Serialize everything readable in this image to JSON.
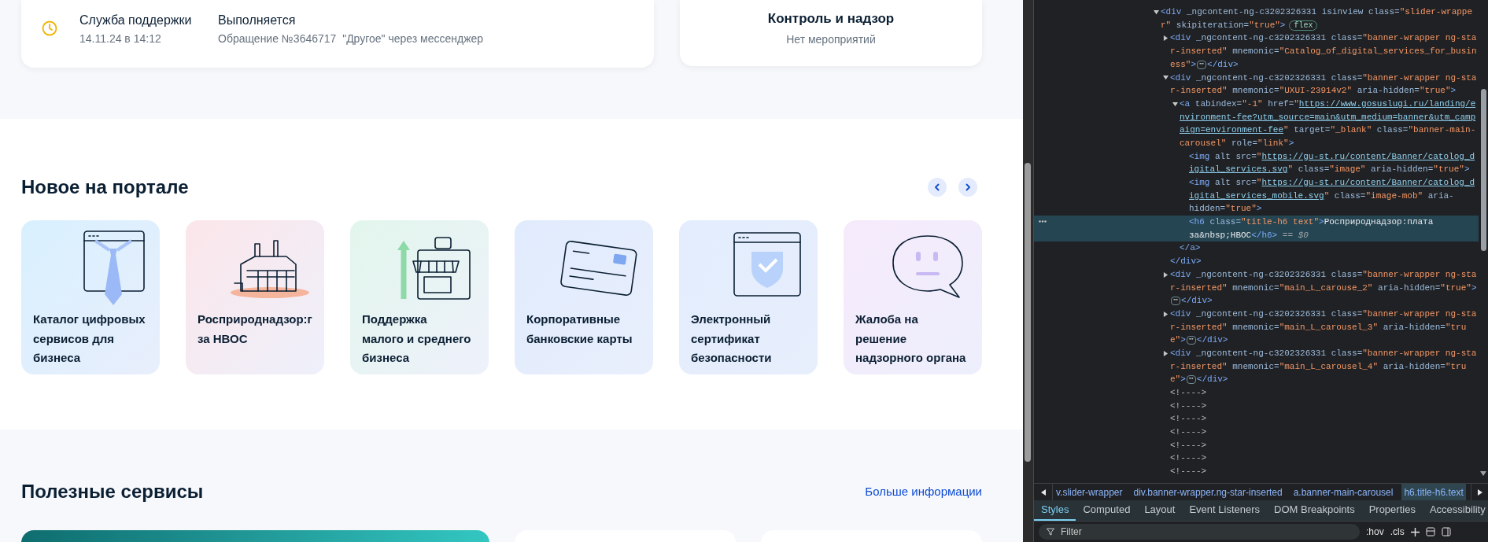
{
  "support_card": {
    "title": "Служба поддержки",
    "date": "14.11.24 в 14:12",
    "status": "Выполняется",
    "description": "Обращение №3646717  \"Другое\" через мессенджер"
  },
  "control_card": {
    "title": "Контроль и надзор",
    "subtitle": "Нет мероприятий"
  },
  "news": {
    "title": "Новое на портале",
    "cards": [
      {
        "kind": "tie-window",
        "title_lines": [
          "Каталог цифровых",
          "сервисов для",
          "бизнеса"
        ]
      },
      {
        "kind": "factory",
        "title_lines": [
          "Росприроднадзор:г",
          "за НВОС"
        ]
      },
      {
        "kind": "shop",
        "title_lines": [
          "Поддержка",
          "малого и среднего",
          "бизнеса"
        ]
      },
      {
        "kind": "bank-card",
        "title_lines": [
          "Корпоративные",
          "банковские карты"
        ]
      },
      {
        "kind": "shield-window",
        "title_lines": [
          "Электронный",
          "сертификат",
          "безопасности"
        ]
      },
      {
        "kind": "speech-bubble",
        "title_lines": [
          "Жалоба на",
          "решение",
          "надзорного органа"
        ]
      }
    ]
  },
  "useful": {
    "title": "Полезные сервисы",
    "link": "Больше информации"
  },
  "devtools": {
    "tree": [
      {
        "selected": false,
        "expanded": true,
        "lines": [
          [
            {
              "kind": "tag",
              "text": "<div"
            },
            {
              "kind": "attr",
              "text": " _ngcontent-ng-c3202326331 isinview class="
            },
            {
              "kind": "val",
              "text": "\"slider-wrappe"
            }
          ],
          [
            {
              "kind": "val",
              "text": "r\""
            },
            {
              "kind": "attr",
              "text": " skipiteration="
            },
            {
              "kind": "val",
              "text": "\"true\""
            },
            {
              "kind": "tag",
              "text": ">"
            },
            {
              "kind": "badge",
              "text": "flex"
            }
          ]
        ],
        "children": [
          {
            "selected": false,
            "expanded": false,
            "lines": [
              [
                {
                  "kind": "tag",
                  "text": "<div"
                },
                {
                  "kind": "attr",
                  "text": " _ngcontent-ng-c3202326331 class="
                },
                {
                  "kind": "val",
                  "text": "\"banner-wrapper ng-sta"
                }
              ],
              [
                {
                  "kind": "val",
                  "text": "r-inserted\""
                },
                {
                  "kind": "attr",
                  "text": " mnemonic="
                },
                {
                  "kind": "val",
                  "text": "\"Catalog_of_digital_services_for_busin"
                }
              ],
              [
                {
                  "kind": "val",
                  "text": "ess\""
                },
                {
                  "kind": "tag",
                  "text": ">"
                },
                {
                  "kind": "ellipsis",
                  "text": "⋯"
                },
                {
                  "kind": "tag",
                  "text": "</div>"
                }
              ]
            ]
          },
          {
            "selected": false,
            "expanded": true,
            "lines": [
              [
                {
                  "kind": "tag",
                  "text": "<div"
                },
                {
                  "kind": "attr",
                  "text": " _ngcontent-ng-c3202326331 class="
                },
                {
                  "kind": "val",
                  "text": "\"banner-wrapper ng-sta"
                }
              ],
              [
                {
                  "kind": "val",
                  "text": "r-inserted\""
                },
                {
                  "kind": "attr",
                  "text": " mnemonic="
                },
                {
                  "kind": "val",
                  "text": "\"UXUI-23914v2\""
                },
                {
                  "kind": "attr",
                  "text": " aria-hidden="
                },
                {
                  "kind": "val",
                  "text": "\"true\""
                },
                {
                  "kind": "tag",
                  "text": ">"
                }
              ]
            ],
            "closing": [
              {
                "kind": "tag",
                "text": "</div>"
              }
            ],
            "children": [
              {
                "selected": false,
                "expanded": true,
                "lines": [
                  [
                    {
                      "kind": "tag",
                      "text": "<a"
                    },
                    {
                      "kind": "attr",
                      "text": " tabindex="
                    },
                    {
                      "kind": "val",
                      "text": "\"-1\""
                    },
                    {
                      "kind": "attr",
                      "text": " href="
                    },
                    {
                      "kind": "val",
                      "text": "\""
                    },
                    {
                      "kind": "link",
                      "text": "https://www.gosuslugi.ru/landing/e"
                    }
                  ],
                  [
                    {
                      "kind": "link",
                      "text": "nvironment-fee?utm_source=main&utm_medium=banner&utm_camp"
                    }
                  ],
                  [
                    {
                      "kind": "link",
                      "text": "aign=environment-fee"
                    },
                    {
                      "kind": "val",
                      "text": "\""
                    },
                    {
                      "kind": "attr",
                      "text": " target="
                    },
                    {
                      "kind": "val",
                      "text": "\"_blank\""
                    },
                    {
                      "kind": "attr",
                      "text": " class="
                    },
                    {
                      "kind": "val",
                      "text": "\"banner-main-"
                    }
                  ],
                  [
                    {
                      "kind": "val",
                      "text": "carousel\""
                    },
                    {
                      "kind": "attr",
                      "text": " role="
                    },
                    {
                      "kind": "val",
                      "text": "\"link\""
                    },
                    {
                      "kind": "tag",
                      "text": ">"
                    }
                  ]
                ],
                "closing": [
                  {
                    "kind": "tag",
                    "text": "</a>"
                  }
                ],
                "children": [
                  {
                    "selected": false,
                    "lines": [
                      [
                        {
                          "kind": "tag",
                          "text": "<img"
                        },
                        {
                          "kind": "attr",
                          "text": " alt src="
                        },
                        {
                          "kind": "val",
                          "text": "\""
                        },
                        {
                          "kind": "link",
                          "text": "https://gu-st.ru/content/Banner/catolog_d"
                        }
                      ],
                      [
                        {
                          "kind": "link",
                          "text": "igital_services.svg"
                        },
                        {
                          "kind": "val",
                          "text": "\""
                        },
                        {
                          "kind": "attr",
                          "text": " class="
                        },
                        {
                          "kind": "val",
                          "text": "\"image\""
                        },
                        {
                          "kind": "attr",
                          "text": " aria-hidden="
                        },
                        {
                          "kind": "val",
                          "text": "\"true\""
                        },
                        {
                          "kind": "tag",
                          "text": ">"
                        }
                      ]
                    ]
                  },
                  {
                    "selected": false,
                    "lines": [
                      [
                        {
                          "kind": "tag",
                          "text": "<img"
                        },
                        {
                          "kind": "attr",
                          "text": " alt src="
                        },
                        {
                          "kind": "val",
                          "text": "\""
                        },
                        {
                          "kind": "link",
                          "text": "https://gu-st.ru/content/Banner/catolog_d"
                        }
                      ],
                      [
                        {
                          "kind": "link",
                          "text": "igital_services_mobile.svg"
                        },
                        {
                          "kind": "val",
                          "text": "\""
                        },
                        {
                          "kind": "attr",
                          "text": " class="
                        },
                        {
                          "kind": "val",
                          "text": "\"image-mob\""
                        },
                        {
                          "kind": "attr",
                          "text": " aria-"
                        }
                      ],
                      [
                        {
                          "kind": "attr",
                          "text": "hidden="
                        },
                        {
                          "kind": "val",
                          "text": "\"true\""
                        },
                        {
                          "kind": "tag",
                          "text": ">"
                        }
                      ]
                    ]
                  },
                  {
                    "selected": true,
                    "lines": [
                      [
                        {
                          "kind": "tag",
                          "text": "<h6"
                        },
                        {
                          "kind": "attr",
                          "text": " class="
                        },
                        {
                          "kind": "val",
                          "text": "\"title-h6 text\""
                        },
                        {
                          "kind": "tag",
                          "text": ">"
                        },
                        {
                          "kind": "text",
                          "text": "Росприроднадзор:плата"
                        }
                      ],
                      [
                        {
                          "kind": "text",
                          "text": "за&nbsp;НВОС"
                        },
                        {
                          "kind": "tag",
                          "text": "</h6>"
                        },
                        {
                          "kind": "dim",
                          "text": " == $0"
                        }
                      ]
                    ]
                  }
                ]
              }
            ]
          },
          {
            "selected": false,
            "expanded": false,
            "lines": [
              [
                {
                  "kind": "tag",
                  "text": "<div"
                },
                {
                  "kind": "attr",
                  "text": " _ngcontent-ng-c3202326331 class="
                },
                {
                  "kind": "val",
                  "text": "\"banner-wrapper ng-sta"
                }
              ],
              [
                {
                  "kind": "val",
                  "text": "r-inserted\""
                },
                {
                  "kind": "attr",
                  "text": " mnemonic="
                },
                {
                  "kind": "val",
                  "text": "\"main_L_carouse_2\""
                },
                {
                  "kind": "attr",
                  "text": " aria-hidden="
                },
                {
                  "kind": "val",
                  "text": "\"true\""
                },
                {
                  "kind": "tag",
                  "text": ">"
                }
              ],
              [
                {
                  "kind": "ellipsis",
                  "text": "⋯"
                },
                {
                  "kind": "tag",
                  "text": "</div>"
                }
              ]
            ]
          },
          {
            "selected": false,
            "expanded": false,
            "lines": [
              [
                {
                  "kind": "tag",
                  "text": "<div"
                },
                {
                  "kind": "attr",
                  "text": " _ngcontent-ng-c3202326331 class="
                },
                {
                  "kind": "val",
                  "text": "\"banner-wrapper ng-sta"
                }
              ],
              [
                {
                  "kind": "val",
                  "text": "r-inserted\""
                },
                {
                  "kind": "attr",
                  "text": " mnemonic="
                },
                {
                  "kind": "val",
                  "text": "\"main_L_carousel_3\""
                },
                {
                  "kind": "attr",
                  "text": " aria-hidden="
                },
                {
                  "kind": "val",
                  "text": "\"tru"
                }
              ],
              [
                {
                  "kind": "val",
                  "text": "e\""
                },
                {
                  "kind": "tag",
                  "text": ">"
                },
                {
                  "kind": "ellipsis",
                  "text": "⋯"
                },
                {
                  "kind": "tag",
                  "text": "</div>"
                }
              ]
            ]
          },
          {
            "selected": false,
            "expanded": false,
            "lines": [
              [
                {
                  "kind": "tag",
                  "text": "<div"
                },
                {
                  "kind": "attr",
                  "text": " _ngcontent-ng-c3202326331 class="
                },
                {
                  "kind": "val",
                  "text": "\"banner-wrapper ng-sta"
                }
              ],
              [
                {
                  "kind": "val",
                  "text": "r-inserted\""
                },
                {
                  "kind": "attr",
                  "text": " mnemonic="
                },
                {
                  "kind": "val",
                  "text": "\"main_L_carousel_4\""
                },
                {
                  "kind": "attr",
                  "text": " aria-hidden="
                },
                {
                  "kind": "val",
                  "text": "\"tru"
                }
              ],
              [
                {
                  "kind": "val",
                  "text": "e\""
                },
                {
                  "kind": "tag",
                  "text": ">"
                },
                {
                  "kind": "ellipsis",
                  "text": "⋯"
                },
                {
                  "kind": "tag",
                  "text": "</div>"
                }
              ]
            ]
          },
          {
            "selected": false,
            "lines": [
              [
                {
                  "kind": "comment",
                  "text": "<!---->"
                }
              ]
            ]
          },
          {
            "selected": false,
            "lines": [
              [
                {
                  "kind": "comment",
                  "text": "<!---->"
                }
              ]
            ]
          },
          {
            "selected": false,
            "lines": [
              [
                {
                  "kind": "comment",
                  "text": "<!---->"
                }
              ]
            ]
          },
          {
            "selected": false,
            "lines": [
              [
                {
                  "kind": "comment",
                  "text": "<!---->"
                }
              ]
            ]
          },
          {
            "selected": false,
            "lines": [
              [
                {
                  "kind": "comment",
                  "text": "<!---->"
                }
              ]
            ]
          },
          {
            "selected": false,
            "lines": [
              [
                {
                  "kind": "comment",
                  "text": "<!---->"
                }
              ]
            ]
          },
          {
            "selected": false,
            "lines": [
              [
                {
                  "kind": "comment",
                  "text": "<!---->"
                }
              ]
            ]
          }
        ]
      }
    ],
    "breadcrumbs": [
      {
        "label": "v.slider-wrapper",
        "selected": false
      },
      {
        "label": "div.banner-wrapper.ng-star-inserted",
        "selected": false
      },
      {
        "label": "a.banner-main-carousel",
        "selected": false
      },
      {
        "label": "h6.title-h6.text",
        "selected": true
      }
    ],
    "tabs": [
      {
        "label": "Styles",
        "selected": true
      },
      {
        "label": "Computed",
        "selected": false
      },
      {
        "label": "Layout",
        "selected": false
      },
      {
        "label": "Event Listeners",
        "selected": false
      },
      {
        "label": "DOM Breakpoints",
        "selected": false
      },
      {
        "label": "Properties",
        "selected": false
      },
      {
        "label": "Accessibility",
        "selected": false
      }
    ],
    "filter": {
      "placeholder": "Filter"
    },
    "toggles": [
      ":hov",
      ".cls"
    ]
  }
}
